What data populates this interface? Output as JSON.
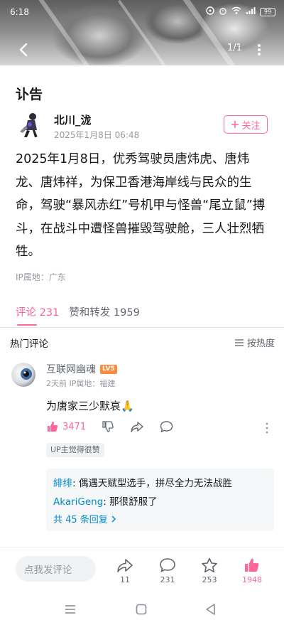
{
  "status_bar": {
    "time": "6:18",
    "icons": [
      "notification-icon",
      "alarm-icon",
      "wifi-icon",
      "signal-icon"
    ],
    "battery": "99"
  },
  "header": {
    "back_icon": "chevron-left-icon",
    "page_indicator": "1/1",
    "more_icon": "more-vertical-icon"
  },
  "post": {
    "title": "讣告",
    "author": "北川_泷",
    "date": "2025年1月8日 06:48",
    "follow_label": "关注",
    "body": "2025年1月8日，优秀驾驶员唐炜虎、唐炜龙、唐炜祥，为保卫香港海岸线与民众的生命，驾驶“暴风赤红”号机甲与怪兽“尾立鼠”搏斗，在战斗中遭怪兽摧毁驾驶舱，三人壮烈牺牲。",
    "ip_location": "IP属地：广东"
  },
  "tabs": [
    {
      "label": "评论 231",
      "active": true
    },
    {
      "label": "赞和转发 1959",
      "active": false
    }
  ],
  "comments_section": {
    "hot_label": "热门评论",
    "sort_label": "按热度"
  },
  "comment": {
    "user": "互联网幽魂",
    "level": "LV5",
    "meta": "2天前 IP属地：福建",
    "text": "为唐家三少默哀🙏",
    "like_count": "3471",
    "up_tag": "UP主觉得很赞",
    "replies": [
      {
        "name": "緋绯",
        "text": ": 偶遇天赋型选手，拼尽全力无法战胜"
      },
      {
        "name": "AkariGeng",
        "text": ": 那很舒服了"
      }
    ],
    "reply_more": "共 45 条回复"
  },
  "bottom_bar": {
    "input_placeholder": "点我发评论",
    "share_count": "11",
    "comment_count": "231",
    "star_count": "253",
    "like_count": "1948"
  },
  "colors": {
    "accent": "#ff6699",
    "link": "#008ac5",
    "secondary_text": "#9499a0",
    "level_badge": "#ff8a3d"
  }
}
